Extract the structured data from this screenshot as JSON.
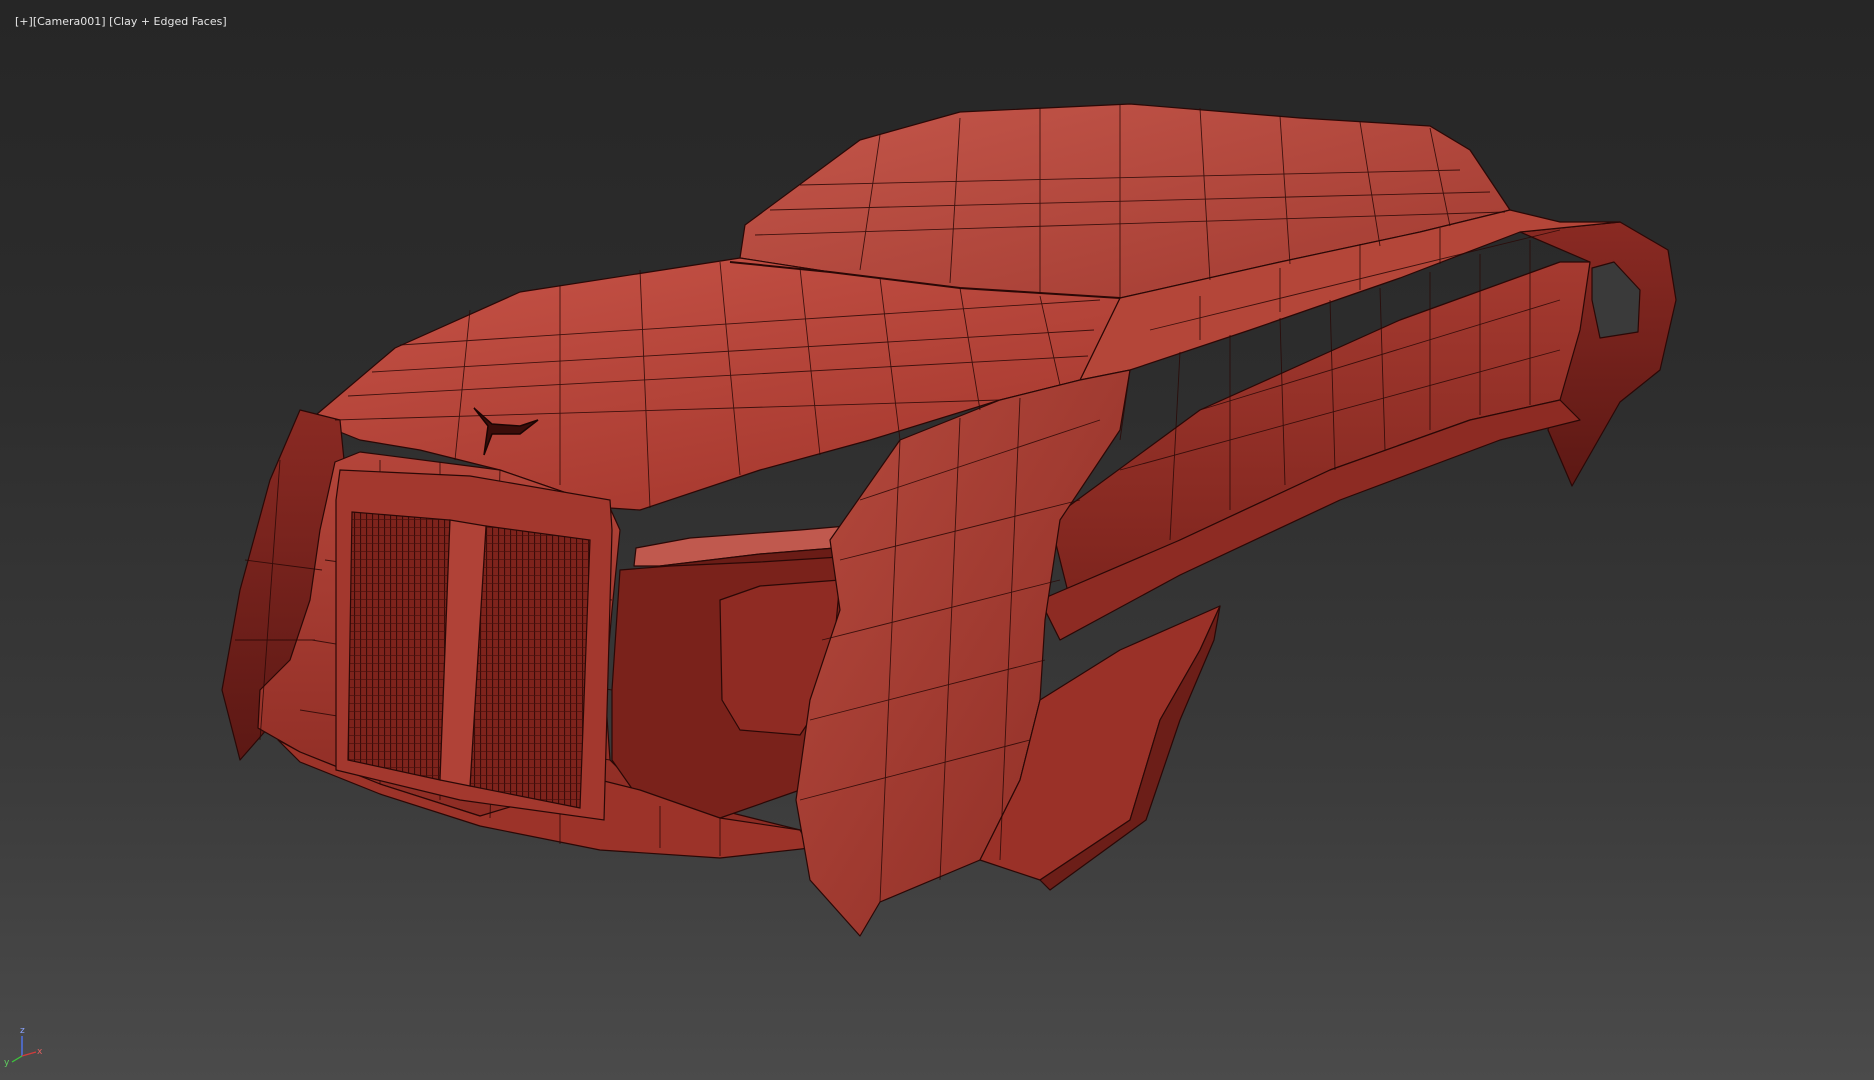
{
  "viewport": {
    "menu_plus": "[+]",
    "camera": "[Camera001]",
    "shading": "[Clay + Edged Faces]"
  },
  "gizmo": {
    "x_label": "x",
    "y_label": "y",
    "z_label": "z"
  },
  "colors": {
    "background_top": "#262626",
    "background_bottom": "#4b4b4b",
    "clay_light": "#bf4d40",
    "clay_mid": "#a33a30",
    "clay_dark": "#6e1f1a",
    "wire": "#2a0806",
    "axis_x": "#d23c3c",
    "axis_y": "#3cc83c",
    "axis_z": "#5078ff"
  }
}
